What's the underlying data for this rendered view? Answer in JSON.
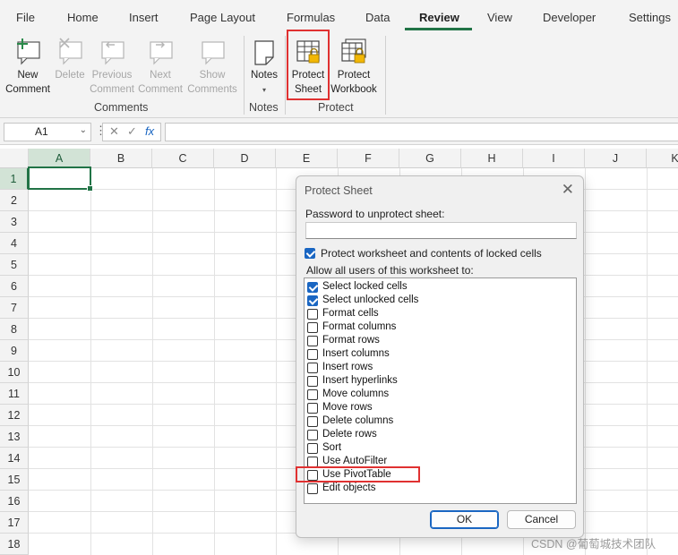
{
  "ribbon_tabs": [
    {
      "label": "File",
      "active": false
    },
    {
      "label": "Home",
      "active": false
    },
    {
      "label": "Insert",
      "active": false
    },
    {
      "label": "Page Layout",
      "active": false
    },
    {
      "label": "Formulas",
      "active": false
    },
    {
      "label": "Data",
      "active": false
    },
    {
      "label": "Review",
      "active": true
    },
    {
      "label": "View",
      "active": false
    },
    {
      "label": "Developer",
      "active": false
    },
    {
      "label": "Settings",
      "active": false
    }
  ],
  "ribbon": {
    "comments": {
      "group_label": "Comments",
      "new": {
        "line1": "New",
        "line2": "Comment"
      },
      "delete": {
        "line1": "Delete"
      },
      "previous": {
        "line1": "Previous",
        "line2": "Comment"
      },
      "next": {
        "line1": "Next",
        "line2": "Comment"
      },
      "show": {
        "line1": "Show",
        "line2": "Comments"
      }
    },
    "notes": {
      "group_label": "Notes",
      "button": "Notes"
    },
    "protect": {
      "group_label": "Protect",
      "sheet": {
        "line1": "Protect",
        "line2": "Sheet"
      },
      "workbook": {
        "line1": "Protect",
        "line2": "Workbook"
      }
    }
  },
  "formula_bar": {
    "name_box": "A1",
    "fx": "fx",
    "cancel": "✕",
    "enter": "✓",
    "value": ""
  },
  "grid": {
    "columns": [
      "A",
      "B",
      "C",
      "D",
      "E",
      "F",
      "G",
      "H",
      "I",
      "J",
      "K"
    ],
    "rows": [
      "1",
      "2",
      "3",
      "4",
      "5",
      "6",
      "7",
      "8",
      "9",
      "10",
      "11",
      "12",
      "13",
      "14",
      "15",
      "16",
      "17",
      "18"
    ],
    "active_cell": "A1"
  },
  "dialog": {
    "title": "Protect Sheet",
    "close": "✕",
    "password_label": "Password to unprotect sheet:",
    "password_value": "",
    "protect_contents_label": "Protect worksheet and contents of locked cells",
    "protect_contents_checked": true,
    "allow_label": "Allow all users of this worksheet to:",
    "options": [
      {
        "label": "Select locked cells",
        "checked": true
      },
      {
        "label": "Select unlocked cells",
        "checked": true
      },
      {
        "label": "Format cells",
        "checked": false
      },
      {
        "label": "Format columns",
        "checked": false
      },
      {
        "label": "Format rows",
        "checked": false
      },
      {
        "label": "Insert columns",
        "checked": false
      },
      {
        "label": "Insert rows",
        "checked": false
      },
      {
        "label": "Insert hyperlinks",
        "checked": false
      },
      {
        "label": "Move columns",
        "checked": false
      },
      {
        "label": "Move rows",
        "checked": false
      },
      {
        "label": "Delete columns",
        "checked": false
      },
      {
        "label": "Delete rows",
        "checked": false
      },
      {
        "label": "Sort",
        "checked": false
      },
      {
        "label": "Use AutoFilter",
        "checked": false
      },
      {
        "label": "Use PivotTable",
        "checked": false
      },
      {
        "label": "Edit objects",
        "checked": false
      }
    ],
    "ok": "OK",
    "cancel": "Cancel"
  },
  "watermark": "CSDN @葡萄城技术团队",
  "colors": {
    "accent": "#217346",
    "highlight": "#e03131",
    "checkbox": "#1a66c2"
  }
}
